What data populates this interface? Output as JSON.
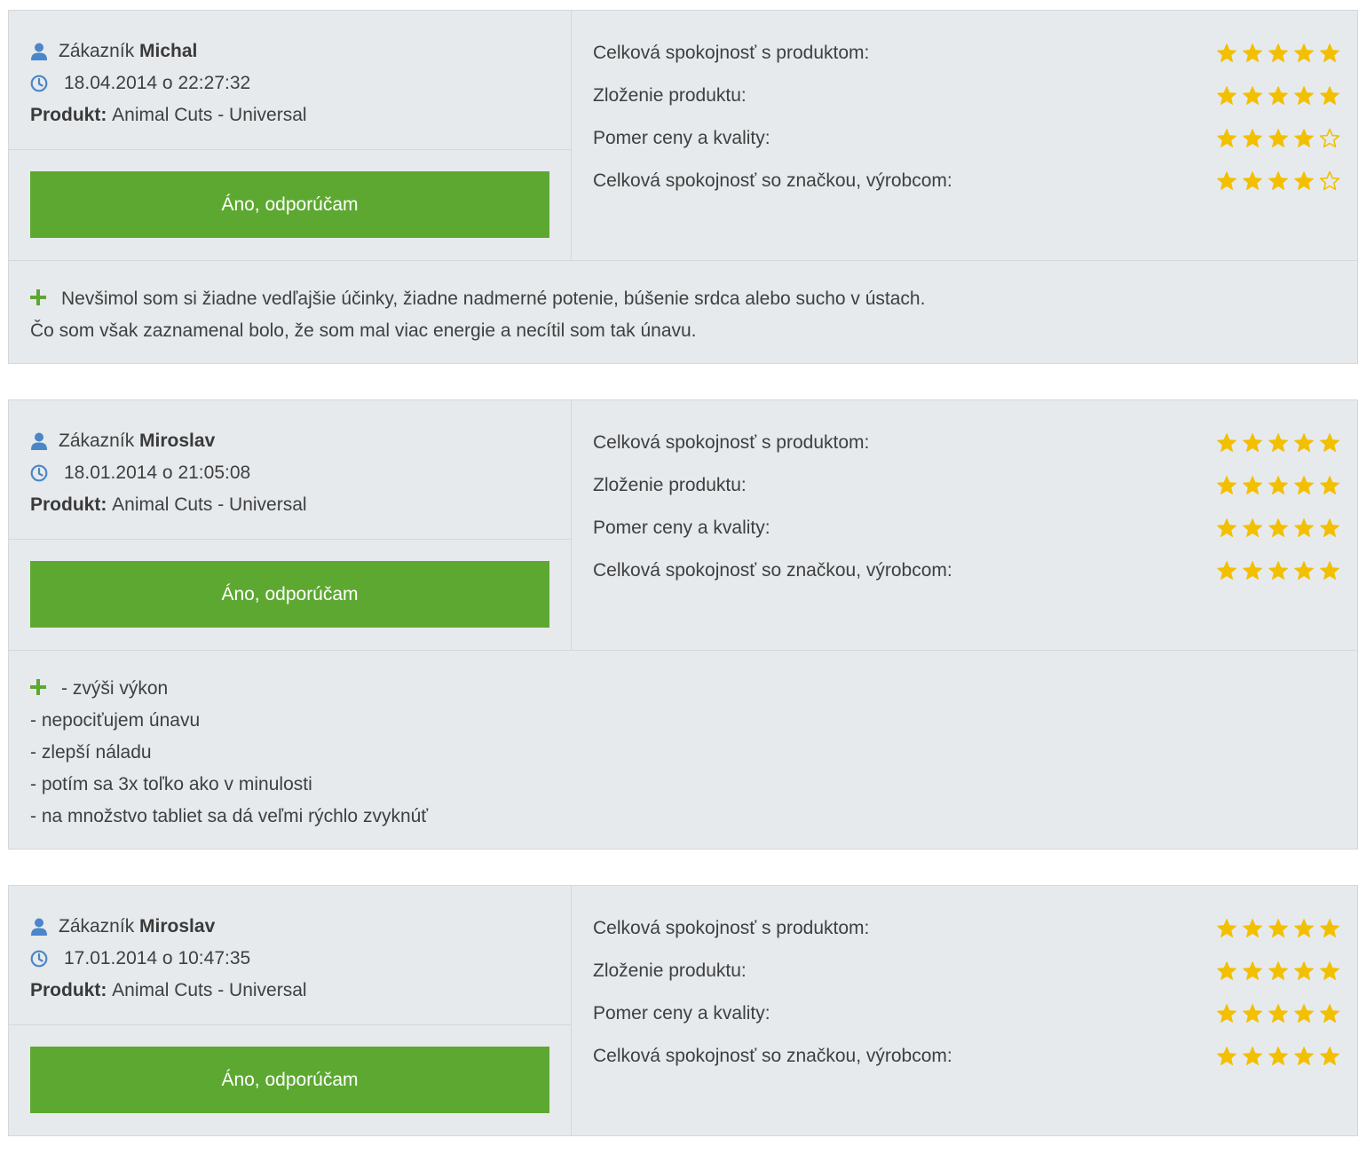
{
  "colors": {
    "accent_green": "#5da831",
    "star_gold": "#f2c000",
    "icon_blue": "#4a86c8",
    "panel_bg": "#e6eaed"
  },
  "labels": {
    "customer_prefix": "Zákazník",
    "product_label": "Produkt:",
    "recommend_button": "Áno, odporúčam"
  },
  "reviews": [
    {
      "customer": "Michal",
      "datetime": "18.04.2014 o 22:27:32",
      "product": "Animal Cuts - Universal",
      "ratings": [
        {
          "label": "Celková spokojnosť s produktom:",
          "stars": 5
        },
        {
          "label": "Zloženie produktu:",
          "stars": 5
        },
        {
          "label": "Pomer ceny a kvality:",
          "stars": 4
        },
        {
          "label": "Celková spokojnosť so značkou, výrobcom:",
          "stars": 4
        }
      ],
      "pros": [
        "Nevšimol som si žiadne vedľajšie účinky, žiadne nadmerné potenie, búšenie srdca alebo sucho v ústach.",
        "Čo som však zaznamenal bolo, že som mal viac energie a necítil som tak únavu."
      ]
    },
    {
      "customer": "Miroslav",
      "datetime": "18.01.2014 o 21:05:08",
      "product": "Animal Cuts - Universal",
      "ratings": [
        {
          "label": "Celková spokojnosť s produktom:",
          "stars": 5
        },
        {
          "label": "Zloženie produktu:",
          "stars": 5
        },
        {
          "label": "Pomer ceny a kvality:",
          "stars": 5
        },
        {
          "label": "Celková spokojnosť so značkou, výrobcom:",
          "stars": 5
        }
      ],
      "pros": [
        "- zvýši výkon",
        "- nepociťujem únavu",
        "- zlepší náladu",
        "- potím sa 3x toľko ako v minulosti",
        "- na množstvo tabliet sa dá veľmi rýchlo zvyknúť"
      ]
    },
    {
      "customer": "Miroslav",
      "datetime": "17.01.2014 o 10:47:35",
      "product": "Animal Cuts - Universal",
      "ratings": [
        {
          "label": "Celková spokojnosť s produktom:",
          "stars": 5
        },
        {
          "label": "Zloženie produktu:",
          "stars": 5
        },
        {
          "label": "Pomer ceny a kvality:",
          "stars": 5
        },
        {
          "label": "Celková spokojnosť so značkou, výrobcom:",
          "stars": 5
        }
      ],
      "pros": []
    }
  ]
}
